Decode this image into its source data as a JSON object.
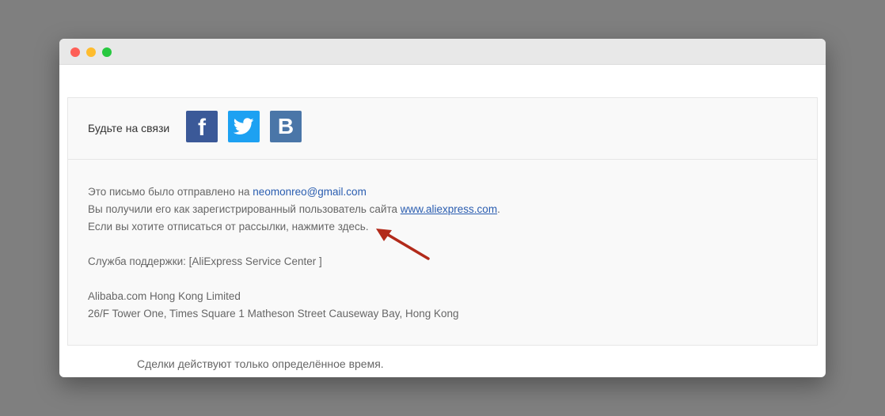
{
  "social": {
    "label": "Будьте на связи",
    "icons": [
      {
        "name": "facebook-icon",
        "glyph": "f",
        "color": "#3b5998"
      },
      {
        "name": "twitter-icon",
        "color": "#1da1f2"
      },
      {
        "name": "vk-icon",
        "glyph": "B",
        "color": "#4a76a8"
      }
    ]
  },
  "footer": {
    "line1_prefix": "Это письмо было отправлено на ",
    "email": "neomonreo@gmail.com",
    "line2_prefix": "Вы получили его как зарегистрированный пользователь сайта ",
    "site": "www.aliexpress.com",
    "line2_suffix": ".",
    "unsubscribe": "Если вы хотите отписаться от рассылки, нажмите здесь.",
    "support": "Служба поддержки: [AliExpress Service Center ]",
    "company": "Alibaba.com Hong Kong Limited",
    "address": "26/F Tower One, Times Square 1 Matheson Street Causeway Bay, Hong Kong"
  },
  "bottom_note": "Сделки действуют только определённое время.",
  "colors": {
    "link": "#2a5db0",
    "arrow": "#b22a1a"
  }
}
